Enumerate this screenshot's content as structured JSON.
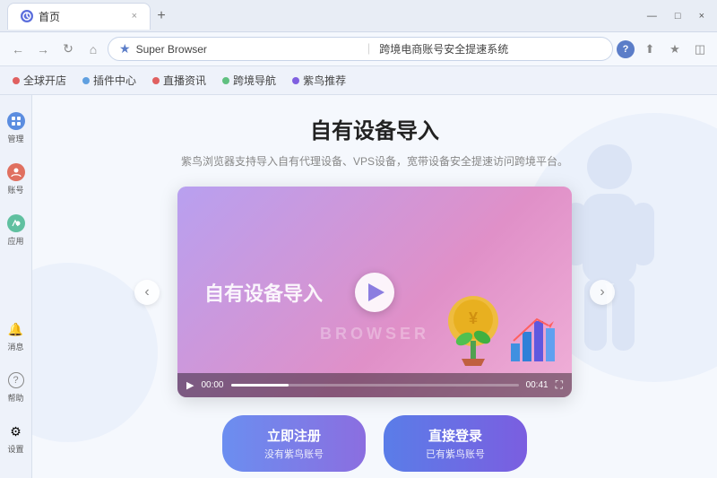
{
  "browser": {
    "tab_title": "首页",
    "tab_close": "×",
    "tab_new": "+",
    "window_controls": [
      "∨",
      "—",
      "□",
      "×"
    ]
  },
  "address_bar": {
    "favicon_text": "★",
    "site_name": "Super Browser",
    "separator": "｜",
    "page_title": "跨境电商账号安全提速系统",
    "icon_question": "?",
    "icon_share": "⬆",
    "icon_star": "✩",
    "icon_menu": "⋮"
  },
  "bookmarks": [
    {
      "label": "全球开店",
      "color": "#e06060"
    },
    {
      "label": "插件中心",
      "color": "#60a0e0"
    },
    {
      "label": "直播资讯",
      "color": "#e06060"
    },
    {
      "label": "跨境导航",
      "color": "#60c080"
    },
    {
      "label": "紫鸟推荐",
      "color": "#8060e0"
    }
  ],
  "sidebar": {
    "items": [
      {
        "label": "管理",
        "color": "#5b8de0"
      },
      {
        "label": "账号",
        "color": "#e07060"
      },
      {
        "label": "应用",
        "color": "#60c0a0"
      }
    ],
    "bottom_items": [
      {
        "label": "消息",
        "icon": "🔔"
      },
      {
        "label": "帮助",
        "icon": "?"
      },
      {
        "label": "设置",
        "icon": "⚙"
      }
    ]
  },
  "page": {
    "title": "自有设备导入",
    "subtitle": "紫鸟浏览器支持导入自有代理设备、VPS设备，宽带设备安全提速访问跨境平台。",
    "video_text": "自有设备导入",
    "video_browser_text": "BROWSER",
    "time_current": "00:00",
    "time_total": "00:41",
    "btn_register_main": "立即注册",
    "btn_register_sub": "没有紫鸟账号",
    "btn_login_main": "直接登录",
    "btn_login_sub": "已有紫鸟账号"
  },
  "arrows": {
    "left": "‹",
    "right": "›"
  }
}
